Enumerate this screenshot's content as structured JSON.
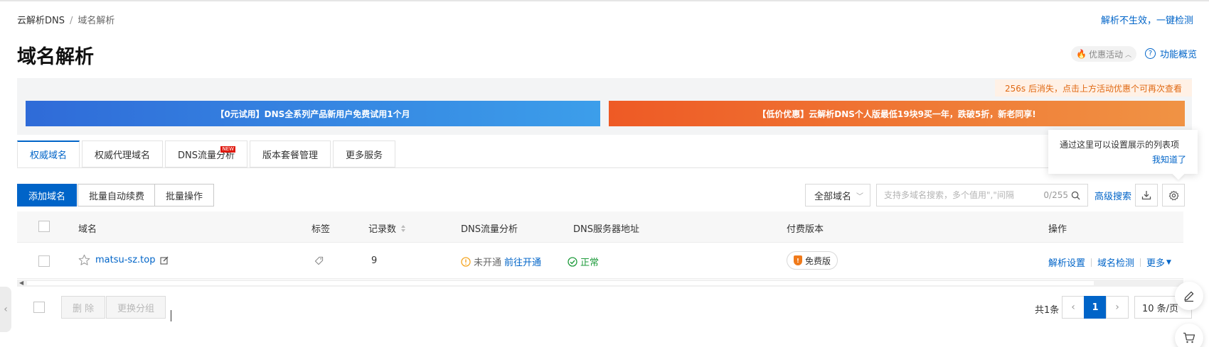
{
  "breadcrumb": {
    "root": "云解析DNS",
    "separator": "/",
    "current": "域名解析"
  },
  "top_right_link": "解析不生效，一键检测",
  "page_title": "域名解析",
  "promo_toggle": "优惠活动",
  "overview_link": "功能概览",
  "countdown_text": "256s 后消失，点击上方活动优惠个可再次查看",
  "banners": {
    "left": "【0元试用】DNS全系列产品新用户免费试用1个月",
    "right": "【低价优惠】云解析DNS个人版最低19块9买一年，跌破5折，新老同享!"
  },
  "tabs": [
    {
      "label": "权威域名",
      "active": true
    },
    {
      "label": "权威代理域名"
    },
    {
      "label": "DNS流量分析",
      "badge": "NEW"
    },
    {
      "label": "版本套餐管理"
    },
    {
      "label": "更多服务"
    }
  ],
  "tooltip": {
    "text": "通过这里可以设置展示的列表项",
    "ok": "我知道了"
  },
  "toolbar": {
    "add_domain": "添加域名",
    "batch_renew": "批量自动续费",
    "batch_ops": "批量操作",
    "domain_filter": "全部域名",
    "search_placeholder": "支持多域名搜索，多个值用\",\"间隔",
    "search_count": "0/255",
    "advanced_search": "高级搜索"
  },
  "table": {
    "columns": {
      "domain": "域名",
      "tag": "标签",
      "records": "记录数",
      "dns_traffic": "DNS流量分析",
      "dns_server": "DNS服务器地址",
      "edition": "付费版本",
      "actions": "操作"
    },
    "rows": [
      {
        "domain": "matsu-sz.top",
        "records": "9",
        "traffic_status": "未开通",
        "traffic_link": "前往开通",
        "dns_status": "正常",
        "edition": "免费版",
        "action_settings": "解析设置",
        "action_check": "域名检测",
        "action_more": "更多"
      }
    ]
  },
  "footer": {
    "delete": "删 除",
    "change_group": "更换分组",
    "total": "共1条",
    "current_page": "1",
    "page_size": "10 条/页"
  },
  "colors": {
    "primary": "#0064c8",
    "success": "#1f9b3c",
    "warning": "#f5a623",
    "banner_blue": "#3c8ee4",
    "banner_orange": "#ee6a2d"
  }
}
